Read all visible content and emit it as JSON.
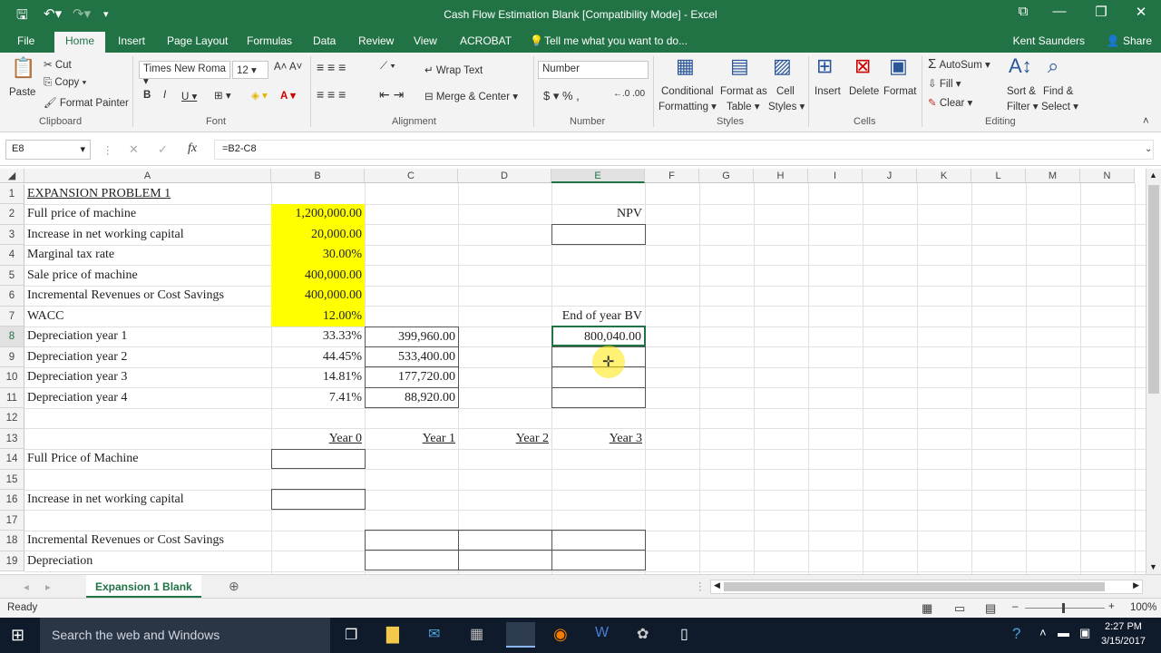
{
  "window": {
    "title": "Cash Flow Estimation Blank  [Compatibility Mode] - Excel"
  },
  "ribbon_tabs": [
    "File",
    "Home",
    "Insert",
    "Page Layout",
    "Formulas",
    "Data",
    "Review",
    "View",
    "ACROBAT"
  ],
  "tell_me": "Tell me what you want to do...",
  "user": "Kent Saunders",
  "share": "Share",
  "ribbon": {
    "clipboard": {
      "paste": "Paste",
      "cut": "Cut",
      "copy": "Copy",
      "format_painter": "Format Painter",
      "label": "Clipboard"
    },
    "font": {
      "family": "Times New Roma",
      "size": "12",
      "label": "Font"
    },
    "alignment": {
      "wrap": "Wrap Text",
      "merge": "Merge & Center",
      "label": "Alignment"
    },
    "number": {
      "format": "Number",
      "label": "Number"
    },
    "styles": {
      "conditional_1": "Conditional",
      "conditional_2": "Formatting",
      "format_as_1": "Format as",
      "format_as_2": "Table",
      "cell_1": "Cell",
      "cell_2": "Styles",
      "label": "Styles"
    },
    "cells": {
      "insert": "Insert",
      "delete": "Delete",
      "format": "Format",
      "label": "Cells"
    },
    "editing": {
      "autosum": "AutoSum",
      "fill": "Fill",
      "clear": "Clear",
      "sort_1": "Sort &",
      "sort_2": "Filter",
      "find_1": "Find &",
      "find_2": "Select",
      "label": "Editing"
    }
  },
  "formula_bar": {
    "name_box": "E8",
    "fx": "fx",
    "formula": "=B2-C8"
  },
  "columns": [
    "A",
    "B",
    "C",
    "D",
    "E",
    "F",
    "G",
    "H",
    "I",
    "J",
    "K",
    "L",
    "M",
    "N"
  ],
  "rows": [
    "1",
    "2",
    "3",
    "4",
    "5",
    "6",
    "7",
    "8",
    "9",
    "10",
    "11",
    "12",
    "13",
    "14",
    "15",
    "16",
    "17",
    "18",
    "19"
  ],
  "cells": {
    "A1": "EXPANSION PROBLEM 1",
    "A2": "Full price of machine",
    "A3": "Increase in net working capital",
    "A4": "Marginal tax rate",
    "A5": "Sale price of machine",
    "A6": "Incremental Revenues or Cost Savings",
    "A7": "WACC",
    "A8": "Depreciation year 1",
    "A9": "Depreciation year 2",
    "A10": "Depreciation year 3",
    "A11": "Depreciation year 4",
    "A14": "Full Price of Machine",
    "A16": "Increase in net working capital",
    "A18": "Incremental Revenues or Cost Savings",
    "A19": "Depreciation",
    "B2": "1,200,000.00",
    "B3": "20,000.00",
    "B4": "30.00%",
    "B5": "400,000.00",
    "B6": "400,000.00",
    "B7": "12.00%",
    "B8": "33.33%",
    "B9": "44.45%",
    "B10": "14.81%",
    "B11": "7.41%",
    "B13": "Year 0",
    "C8": "399,960.00",
    "C9": "533,400.00",
    "C10": "177,720.00",
    "C11": "88,920.00",
    "C13": "Year 1",
    "D13": "Year 2",
    "E2": "NPV",
    "E7": "End of year BV",
    "E8": "800,040.00",
    "E13": "Year 3"
  },
  "sheet_tab": "Expansion 1 Blank",
  "status": {
    "ready": "Ready",
    "zoom": "100%"
  },
  "taskbar": {
    "search": "Search the web and Windows",
    "time": "2:27 PM",
    "date": "3/15/2017"
  },
  "colors": {
    "excel_green": "#217346",
    "highlight": "#ffff00"
  }
}
